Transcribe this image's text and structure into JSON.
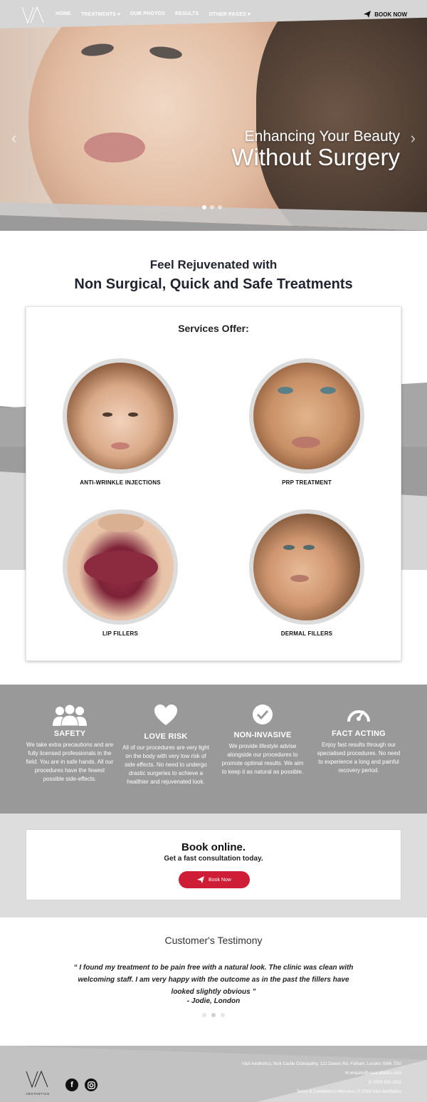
{
  "nav": {
    "items": [
      "HOME",
      "TREATMENTS",
      "OUR PHOTOS",
      "RESULTS",
      "OTHER PAGES"
    ],
    "book_now": "BOOK NOW"
  },
  "hero": {
    "line1": "Enhancing Your Beauty",
    "line2": "Without Surgery",
    "prev_arrow": "‹",
    "next_arrow": "›"
  },
  "intro": {
    "line1": "Feel Rejuvenated with",
    "line2": "Non Surgical, Quick and Safe Treatments"
  },
  "services": {
    "title": "Services Offer:",
    "items": [
      {
        "label": "ANTI-WRINKLE INJECTIONS"
      },
      {
        "label": "PRP TREATMENT"
      },
      {
        "label": "LIP FILLERS"
      },
      {
        "label": "DERMAL FILLERS"
      }
    ]
  },
  "features": [
    {
      "title": "SAFETY",
      "icon": "people-icon",
      "text": "We take extra precautions and are fully licensed professionals in the field. You are in safe hands. All our procedures have the fewest possible side-effects."
    },
    {
      "title": "LOVE RISK",
      "icon": "heart-icon",
      "text": "All of our procedures are very light on the body with very low risk of side effects. No need to undergo drastic surgeries to achieve a healthier and rejuvenated look."
    },
    {
      "title": "NON-INVASIVE",
      "icon": "check-circle-icon",
      "text": "We provide lifestyle advise alongside our procedures to promote optimal results. We aim to keep it as natural as possible."
    },
    {
      "title": "FACT ACTING",
      "icon": "speedometer-icon",
      "text": "Enjoy fast results through our specialised procedures. No need to experience a long and painful recovery period."
    }
  ],
  "book": {
    "heading": "Book online.",
    "sub": "Get a fast consultation today.",
    "button": "Book Now"
  },
  "testimony": {
    "title": "Customer's Testimony",
    "quote": "“ I found my treatment to be pain free with a natural look. The clinic was clean with welcoming staff. I am very happy with the outcome as in the past the fillers have looked slightly obvious ”",
    "author": "- Jodie, London"
  },
  "footer": {
    "logo_sub": "AESTHETICS",
    "address": "V&A Aesthetics, Nick Castle Osteopathy, 121 Dawes Rd, Fulham, London SW6 7DU",
    "email": "enquiry@vaaesthetics.com",
    "phone": "0203 633 1611",
    "legal": "Terms & Conditions | Aftercare | © 2018 V&A Aesthetics"
  },
  "colors": {
    "accent": "#cf1d37",
    "band_grey": "#999999",
    "light_grey": "#dddddd"
  }
}
